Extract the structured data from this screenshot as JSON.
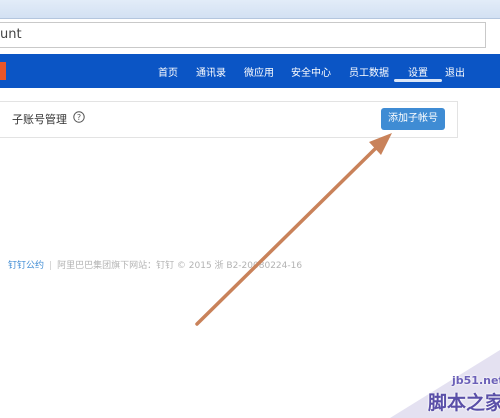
{
  "browser": {
    "address_text": "unt"
  },
  "navbar": {
    "items": [
      "首页",
      "通讯录",
      "微应用",
      "安全中心",
      "员工数据",
      "设置",
      "退出"
    ]
  },
  "panel": {
    "title": "子账号管理",
    "help_icon": "question-circle-icon",
    "add_button_label": "添加子帐号"
  },
  "footer": {
    "link_text": "钉钉公约",
    "separator": "|",
    "text": "阿里巴巴集团旗下网站：钉钉 © 2015 浙 B2-20080224-16"
  },
  "watermark": {
    "domain": "jb51.net",
    "name": "脚本之家"
  },
  "colors": {
    "navbar": "#0b55c5",
    "button": "#3f8cd4",
    "arrow": "#c9825a",
    "logo_stub": "#e8562a"
  }
}
